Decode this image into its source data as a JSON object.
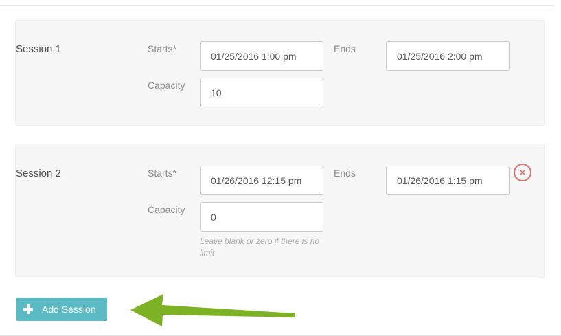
{
  "sessions": [
    {
      "title": "Session 1",
      "starts_label": "Starts*",
      "starts_value": "01/25/2016 1:00 pm",
      "ends_label": "Ends",
      "ends_value": "01/25/2016 2:00 pm",
      "capacity_label": "Capacity",
      "capacity_value": "10"
    },
    {
      "title": "Session 2",
      "starts_label": "Starts*",
      "starts_value": "01/26/2016 12:15 pm",
      "ends_label": "Ends",
      "ends_value": "01/26/2016 1:15 pm",
      "capacity_label": "Capacity",
      "capacity_value": "0",
      "capacity_help": "Leave blank or zero if there is no limit",
      "remove_icon": "close-circle-icon"
    }
  ],
  "add_session": {
    "label": "Add Session",
    "icon": "plus-icon"
  },
  "colors": {
    "accent": "#5bbac3",
    "remove": "#d9736f",
    "arrow": "#7db224",
    "card_bg": "#f6f6f6"
  }
}
